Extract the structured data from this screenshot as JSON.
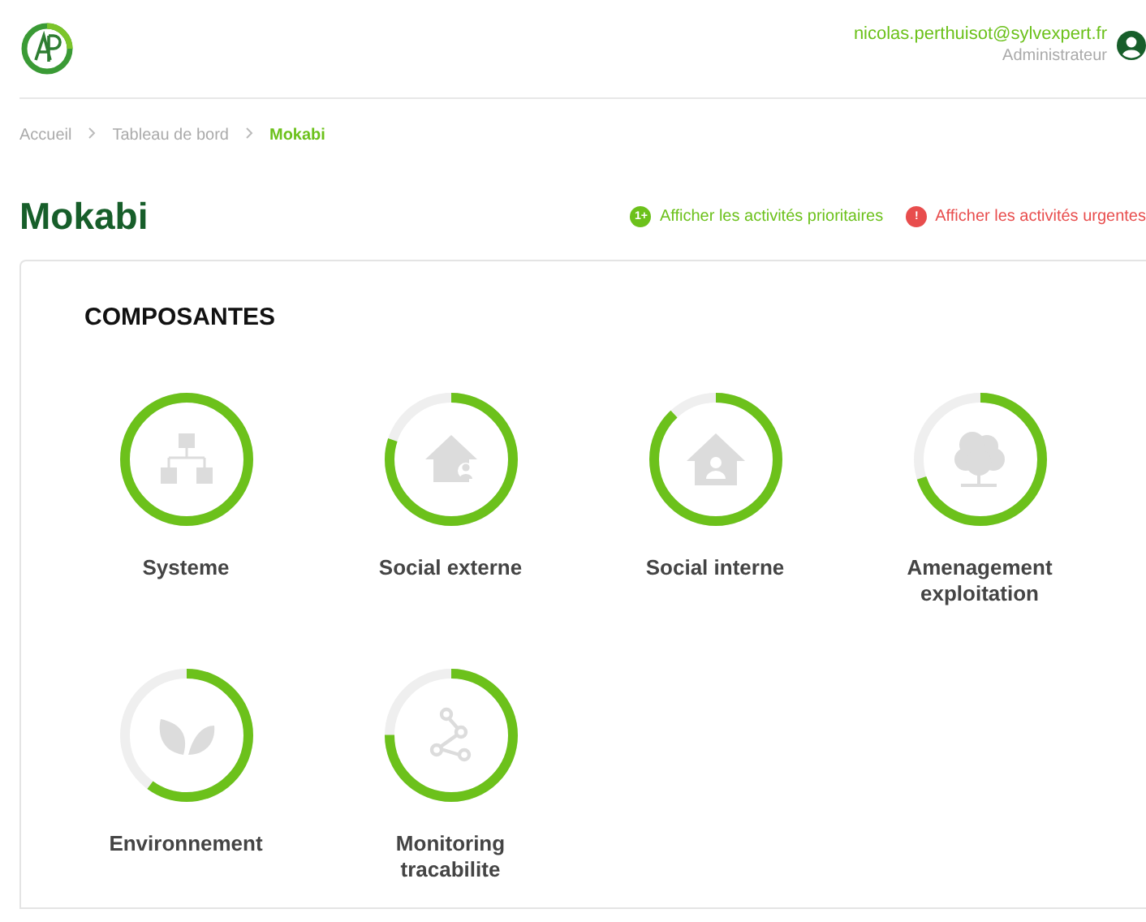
{
  "user": {
    "email": "nicolas.perthuisot@sylvexpert.fr",
    "role": "Administrateur"
  },
  "breadcrumb": [
    {
      "label": "Accueil",
      "current": false
    },
    {
      "label": "Tableau de bord",
      "current": false
    },
    {
      "label": "Mokabi",
      "current": true
    }
  ],
  "page_title": "Mokabi",
  "filters": [
    {
      "kind": "priority",
      "label": "Afficher les activités prioritaires",
      "badge": "1+"
    },
    {
      "kind": "urgent",
      "label": "Afficher les activités urgentes",
      "badge": "!"
    }
  ],
  "section_title": "COMPOSANTES",
  "components": [
    {
      "label": "Systeme",
      "level": 1.0
    },
    {
      "label": "Social externe",
      "level": 0.8
    },
    {
      "label": "Social interne",
      "level": 0.88
    },
    {
      "label": "Amenagement exploitation",
      "level": 0.7
    },
    {
      "label": "Environnement",
      "level": 0.6
    },
    {
      "label": "Monitoring tracabilite",
      "level": 0.75
    }
  ]
}
